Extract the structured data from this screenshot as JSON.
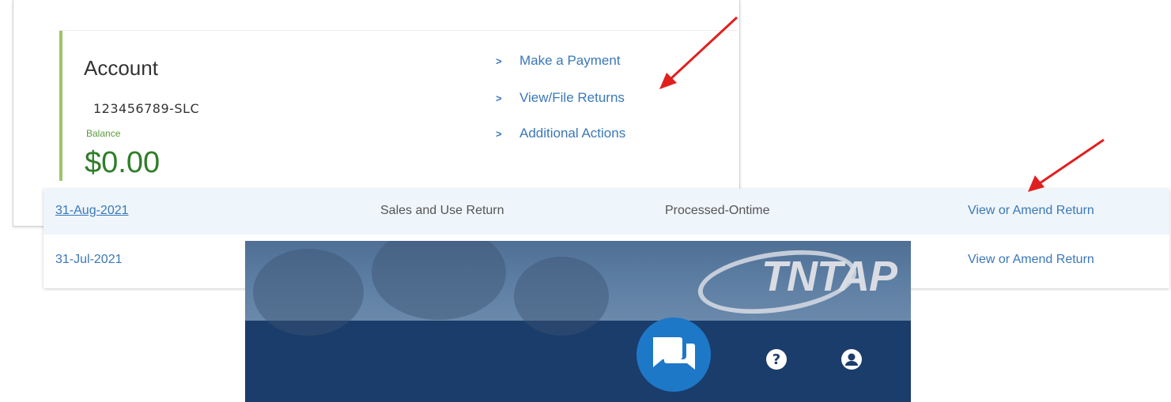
{
  "account": {
    "title": "Account",
    "number": "123456789-SLC",
    "balance_label": "Balance",
    "balance_value": "$0.00",
    "actions": [
      {
        "label": "Make a Payment"
      },
      {
        "label": "View/File Returns"
      },
      {
        "label": "Additional Actions"
      }
    ]
  },
  "returns": {
    "rows": [
      {
        "date": "31-Aug-2021",
        "type": "Sales and Use Return",
        "status": "Processed-Ontime",
        "action": "View or Amend Return"
      },
      {
        "date": "31-Jul-2021",
        "type": "",
        "status": "",
        "action": "View or Amend Return"
      }
    ]
  },
  "header": {
    "logo_text": "TNTAP",
    "help_glyph": "?"
  },
  "colors": {
    "accent_green": "#9dc46c",
    "balance_green": "#2f7d2a",
    "link_blue": "#3b78b8",
    "header_navy": "#1a3d6b",
    "chat_blue": "#1e78c8",
    "arrow_red": "#e02020"
  },
  "icons": [
    "chevron-right-icon",
    "chat-icon",
    "help-icon",
    "user-account-icon",
    "annotation-arrow"
  ]
}
